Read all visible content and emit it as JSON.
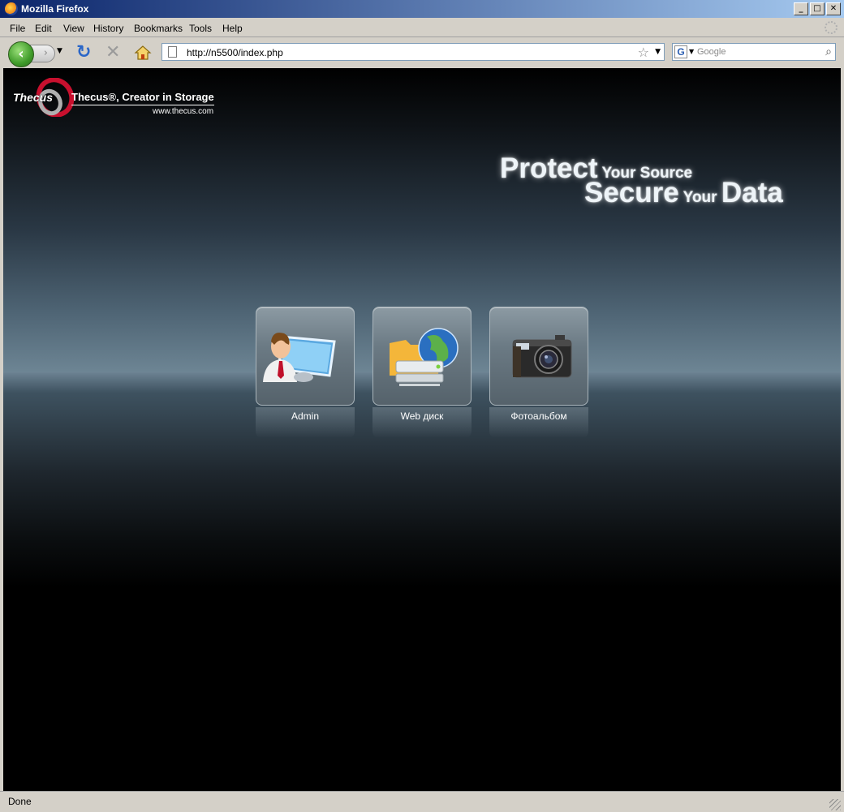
{
  "window": {
    "title": "Mozilla Firefox",
    "controls": {
      "minimize": "_",
      "maximize": "□",
      "close": "✕"
    }
  },
  "menubar": {
    "items": [
      {
        "label": "File",
        "accesskey": "F"
      },
      {
        "label": "Edit",
        "accesskey": "E"
      },
      {
        "label": "View",
        "accesskey": "V"
      },
      {
        "label": "History",
        "accesskey": "s"
      },
      {
        "label": "Bookmarks",
        "accesskey": "B"
      },
      {
        "label": "Tools",
        "accesskey": "T"
      },
      {
        "label": "Help",
        "accesskey": "H"
      }
    ]
  },
  "navbar": {
    "back_icon": "back-arrow-icon",
    "forward_icon": "forward-arrow-icon",
    "reload_icon": "reload-icon",
    "stop_icon": "stop-icon",
    "home_icon": "home-icon",
    "url": "http://n5500/index.php",
    "search": {
      "engine": "G",
      "placeholder": "Google"
    }
  },
  "page": {
    "logo": {
      "brand": "Thecus",
      "tagline": "Thecus®, Creator in Storage",
      "url": "www.thecus.com"
    },
    "slogan": {
      "line1": [
        {
          "text": "Protect",
          "size": "big"
        },
        {
          "text": " Your Source",
          "size": "small"
        }
      ],
      "line2": [
        {
          "text": "Secure",
          "size": "big"
        },
        {
          "text": " Your ",
          "size": "small"
        },
        {
          "text": "Data",
          "size": "big"
        }
      ]
    },
    "tiles": [
      {
        "id": "admin",
        "label": "Admin",
        "icon": "admin-user-monitor-icon"
      },
      {
        "id": "webdisk",
        "label": "Web диск",
        "icon": "web-disk-globe-icon"
      },
      {
        "id": "photo",
        "label": "Фотоальбом",
        "icon": "camera-icon"
      }
    ]
  },
  "statusbar": {
    "text": "Done"
  },
  "colors": {
    "titlebar_start": "#0a246a",
    "titlebar_end": "#a6caf0",
    "chrome": "#d4d0c8"
  }
}
